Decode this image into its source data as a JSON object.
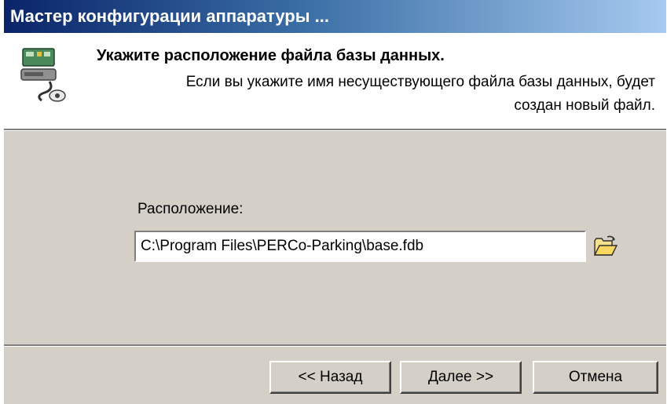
{
  "window": {
    "title": "Мастер конфигурации аппаратуры ..."
  },
  "header": {
    "title": "Укажите расположение файла базы данных.",
    "subtitle": "Если вы укажите имя несуществующего файла базы данных, будет создан новый файл.",
    "icon": "hardware-wizard-icon"
  },
  "main": {
    "location_label": "Расположение:",
    "location_value": "C:\\Program Files\\PERCo-Parking\\base.fdb",
    "browse_icon": "open-folder-icon"
  },
  "buttons": {
    "back": "<< Назад",
    "next": "Далее >>",
    "cancel": "Отмена"
  },
  "colors": {
    "titlebar_start": "#0a246a",
    "titlebar_end": "#a6caf0",
    "dialog_bg": "#d4d0c8"
  }
}
